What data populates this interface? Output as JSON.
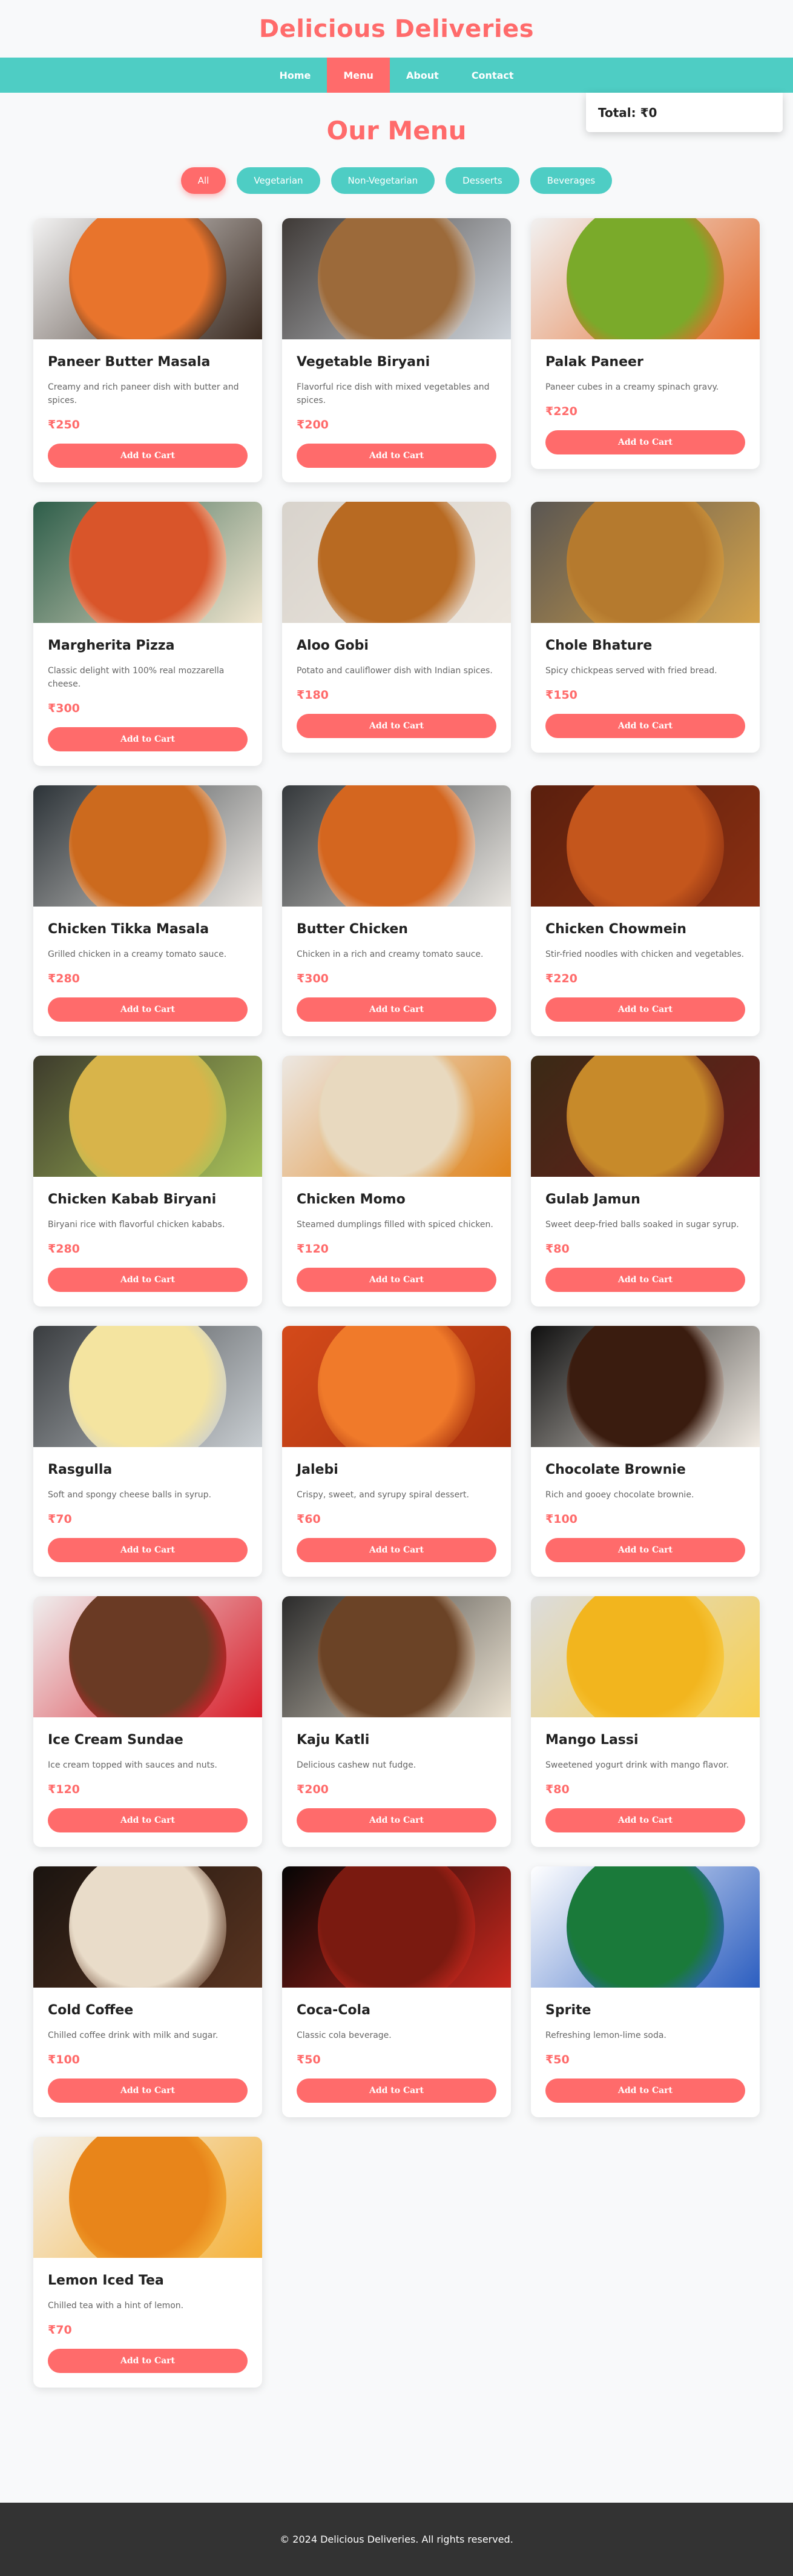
{
  "brand": "Delicious Deliveries",
  "nav": [
    {
      "label": "Home",
      "active": false
    },
    {
      "label": "Menu",
      "active": true
    },
    {
      "label": "About",
      "active": false
    },
    {
      "label": "Contact",
      "active": false
    }
  ],
  "cart": {
    "total_label": "Total: ₹0"
  },
  "page_title": "Our Menu",
  "filters": [
    {
      "label": "All",
      "active": true
    },
    {
      "label": "Vegetarian",
      "active": false
    },
    {
      "label": "Non-Vegetarian",
      "active": false
    },
    {
      "label": "Desserts",
      "active": false
    },
    {
      "label": "Beverages",
      "active": false
    }
  ],
  "items": [
    {
      "name": "Paneer Butter Masala",
      "desc": "Creamy and rich paneer dish with butter and spices.",
      "price": "₹250",
      "button": "Add to Cart",
      "image_icon": "paneer-curry-icon",
      "colors": [
        "#f3f3f3",
        "#e8742c",
        "#3a2a20"
      ]
    },
    {
      "name": "Vegetable Biryani",
      "desc": "Flavorful rice dish with mixed vegetables and spices.",
      "price": "₹200",
      "button": "Add to Cart",
      "image_icon": "biryani-bowl-icon",
      "colors": [
        "#3f3a37",
        "#9c6a3a",
        "#cfd5dc"
      ]
    },
    {
      "name": "Palak Paneer",
      "desc": "Paneer cubes in a creamy spinach gravy.",
      "price": "₹220",
      "button": "Add to Cart",
      "image_icon": "spinach-curry-icon",
      "colors": [
        "#f1f1f1",
        "#7aaa2a",
        "#e46a2a"
      ]
    },
    {
      "name": "Margherita Pizza",
      "desc": "Classic delight with 100% real mozzarella cheese.",
      "price": "₹300",
      "button": "Add to Cart",
      "image_icon": "pizza-icon",
      "colors": [
        "#2e5e4a",
        "#d9552a",
        "#f0e6cf"
      ]
    },
    {
      "name": "Aloo Gobi",
      "desc": "Potato and cauliflower dish with Indian spices.",
      "price": "₹180",
      "button": "Add to Cart",
      "image_icon": "aloo-gobi-icon",
      "colors": [
        "#d8d3cc",
        "#b86a22",
        "#ece6de"
      ]
    },
    {
      "name": "Chole Bhature",
      "desc": "Spicy chickpeas served with fried bread.",
      "price": "₹150",
      "button": "Add to Cart",
      "image_icon": "chole-bhature-icon",
      "colors": [
        "#5a5652",
        "#b57a2e",
        "#d4a24a"
      ]
    },
    {
      "name": "Chicken Tikka Masala",
      "desc": "Grilled chicken in a creamy tomato sauce.",
      "price": "₹280",
      "button": "Add to Cart",
      "image_icon": "tikka-masala-icon",
      "colors": [
        "#2c3338",
        "#cc6a1e",
        "#ece8e3"
      ]
    },
    {
      "name": "Butter Chicken",
      "desc": "Chicken in a rich and creamy tomato sauce.",
      "price": "₹300",
      "button": "Add to Cart",
      "image_icon": "butter-chicken-icon",
      "colors": [
        "#34383b",
        "#d4661f",
        "#e9e6e1"
      ]
    },
    {
      "name": "Chicken Chowmein",
      "desc": "Stir-fried noodles with chicken and vegetables.",
      "price": "₹220",
      "button": "Add to Cart",
      "image_icon": "noodles-icon",
      "colors": [
        "#5a1f0d",
        "#c4561c",
        "#8a2f12"
      ]
    },
    {
      "name": "Chicken Kabab Biryani",
      "desc": "Biryani rice with flavorful chicken kababs.",
      "price": "₹280",
      "button": "Add to Cart",
      "image_icon": "kabab-biryani-icon",
      "colors": [
        "#3d3b2c",
        "#d8b44a",
        "#a8c25a"
      ]
    },
    {
      "name": "Chicken Momo",
      "desc": "Steamed dumplings filled with spiced chicken.",
      "price": "₹120",
      "button": "Add to Cart",
      "image_icon": "momo-icon",
      "colors": [
        "#ece8e3",
        "#e8d9bf",
        "#e0841c"
      ]
    },
    {
      "name": "Gulab Jamun",
      "desc": "Sweet deep-fried balls soaked in sugar syrup.",
      "price": "₹80",
      "button": "Add to Cart",
      "image_icon": "gulab-jamun-icon",
      "colors": [
        "#3a2a16",
        "#c78a2a",
        "#6e1e1a"
      ]
    },
    {
      "name": "Rasgulla",
      "desc": "Soft and spongy cheese balls in syrup.",
      "price": "₹70",
      "button": "Add to Cart",
      "image_icon": "rasgulla-icon",
      "colors": [
        "#3a3d40",
        "#f4e4a0",
        "#c9ced2"
      ]
    },
    {
      "name": "Jalebi",
      "desc": "Crispy, sweet, and syrupy spiral dessert.",
      "price": "₹60",
      "button": "Add to Cart",
      "image_icon": "jalebi-icon",
      "colors": [
        "#d44a1a",
        "#f07a2a",
        "#a8310e"
      ]
    },
    {
      "name": "Chocolate Brownie",
      "desc": "Rich and gooey chocolate brownie.",
      "price": "₹100",
      "button": "Add to Cart",
      "image_icon": "brownie-icon",
      "colors": [
        "#101010",
        "#3a1c0f",
        "#f2ece4"
      ]
    },
    {
      "name": "Ice Cream Sundae",
      "desc": "Ice cream topped with sauces and nuts.",
      "price": "₹120",
      "button": "Add to Cart",
      "image_icon": "sundae-icon",
      "colors": [
        "#efefef",
        "#6a3a24",
        "#d81e2a"
      ]
    },
    {
      "name": "Kaju Katli",
      "desc": "Delicious cashew nut fudge.",
      "price": "₹200",
      "button": "Add to Cart",
      "image_icon": "kaju-katli-icon",
      "colors": [
        "#2b2b2b",
        "#6b4326",
        "#ece3d2"
      ]
    },
    {
      "name": "Mango Lassi",
      "desc": "Sweetened yogurt drink with mango flavor.",
      "price": "₹80",
      "button": "Add to Cart",
      "image_icon": "lassi-icon",
      "colors": [
        "#dcdcdc",
        "#f2b51e",
        "#f8d050"
      ]
    },
    {
      "name": "Cold Coffee",
      "desc": "Chilled coffee drink with milk and sugar.",
      "price": "₹100",
      "button": "Add to Cart",
      "image_icon": "cold-coffee-icon",
      "colors": [
        "#1a1410",
        "#e9dcc9",
        "#5a3420"
      ]
    },
    {
      "name": "Coca-Cola",
      "desc": "Classic cola beverage.",
      "price": "₹50",
      "button": "Add to Cart",
      "image_icon": "cola-icon",
      "colors": [
        "#050505",
        "#7a1a10",
        "#c8281e"
      ]
    },
    {
      "name": "Sprite",
      "desc": "Refreshing lemon-lime soda.",
      "price": "₹50",
      "button": "Add to Cart",
      "image_icon": "sprite-can-icon",
      "colors": [
        "#ffffff",
        "#1a7a3a",
        "#2c5ec0"
      ]
    },
    {
      "name": "Lemon Iced Tea",
      "desc": "Chilled tea with a hint of lemon.",
      "price": "₹70",
      "button": "Add to Cart",
      "image_icon": "iced-tea-icon",
      "colors": [
        "#f3f0ea",
        "#e8851a",
        "#f5b23a"
      ]
    }
  ],
  "footer": "© 2024 Delicious Deliveries. All rights reserved."
}
